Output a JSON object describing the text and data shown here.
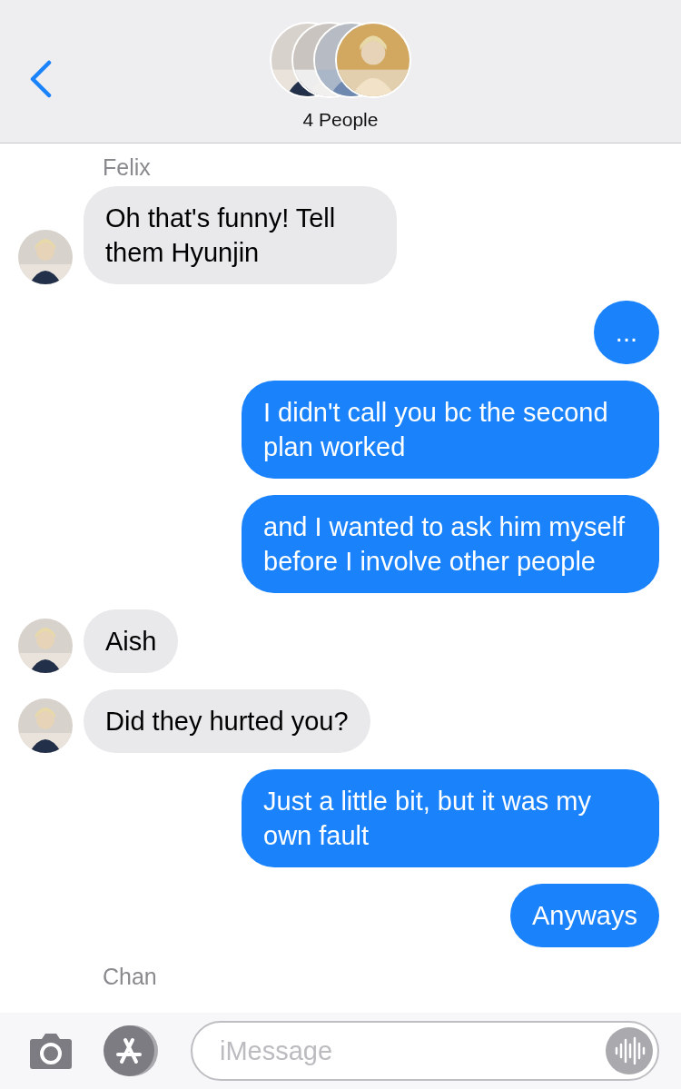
{
  "header": {
    "title": "4 People"
  },
  "messages": [
    {
      "kind": "sender",
      "text": "Felix"
    },
    {
      "kind": "incoming",
      "text": "Oh that's funny! Tell them Hyunjin",
      "avatar": true
    },
    {
      "kind": "outgoing",
      "text": "..."
    },
    {
      "kind": "outgoing",
      "text": "I didn't call you bc the second plan worked"
    },
    {
      "kind": "outgoing",
      "text": "and I wanted to ask him myself before I involve other people"
    },
    {
      "kind": "incoming",
      "text": "Aish",
      "avatar": true
    },
    {
      "kind": "incoming",
      "text": "Did they hurted you?",
      "avatar": true
    },
    {
      "kind": "outgoing",
      "text": "Just a little bit, but it was my own fault"
    },
    {
      "kind": "outgoing",
      "text": "Anyways"
    },
    {
      "kind": "sender",
      "text": "Chan"
    }
  ],
  "composer": {
    "placeholder": "iMessage"
  }
}
